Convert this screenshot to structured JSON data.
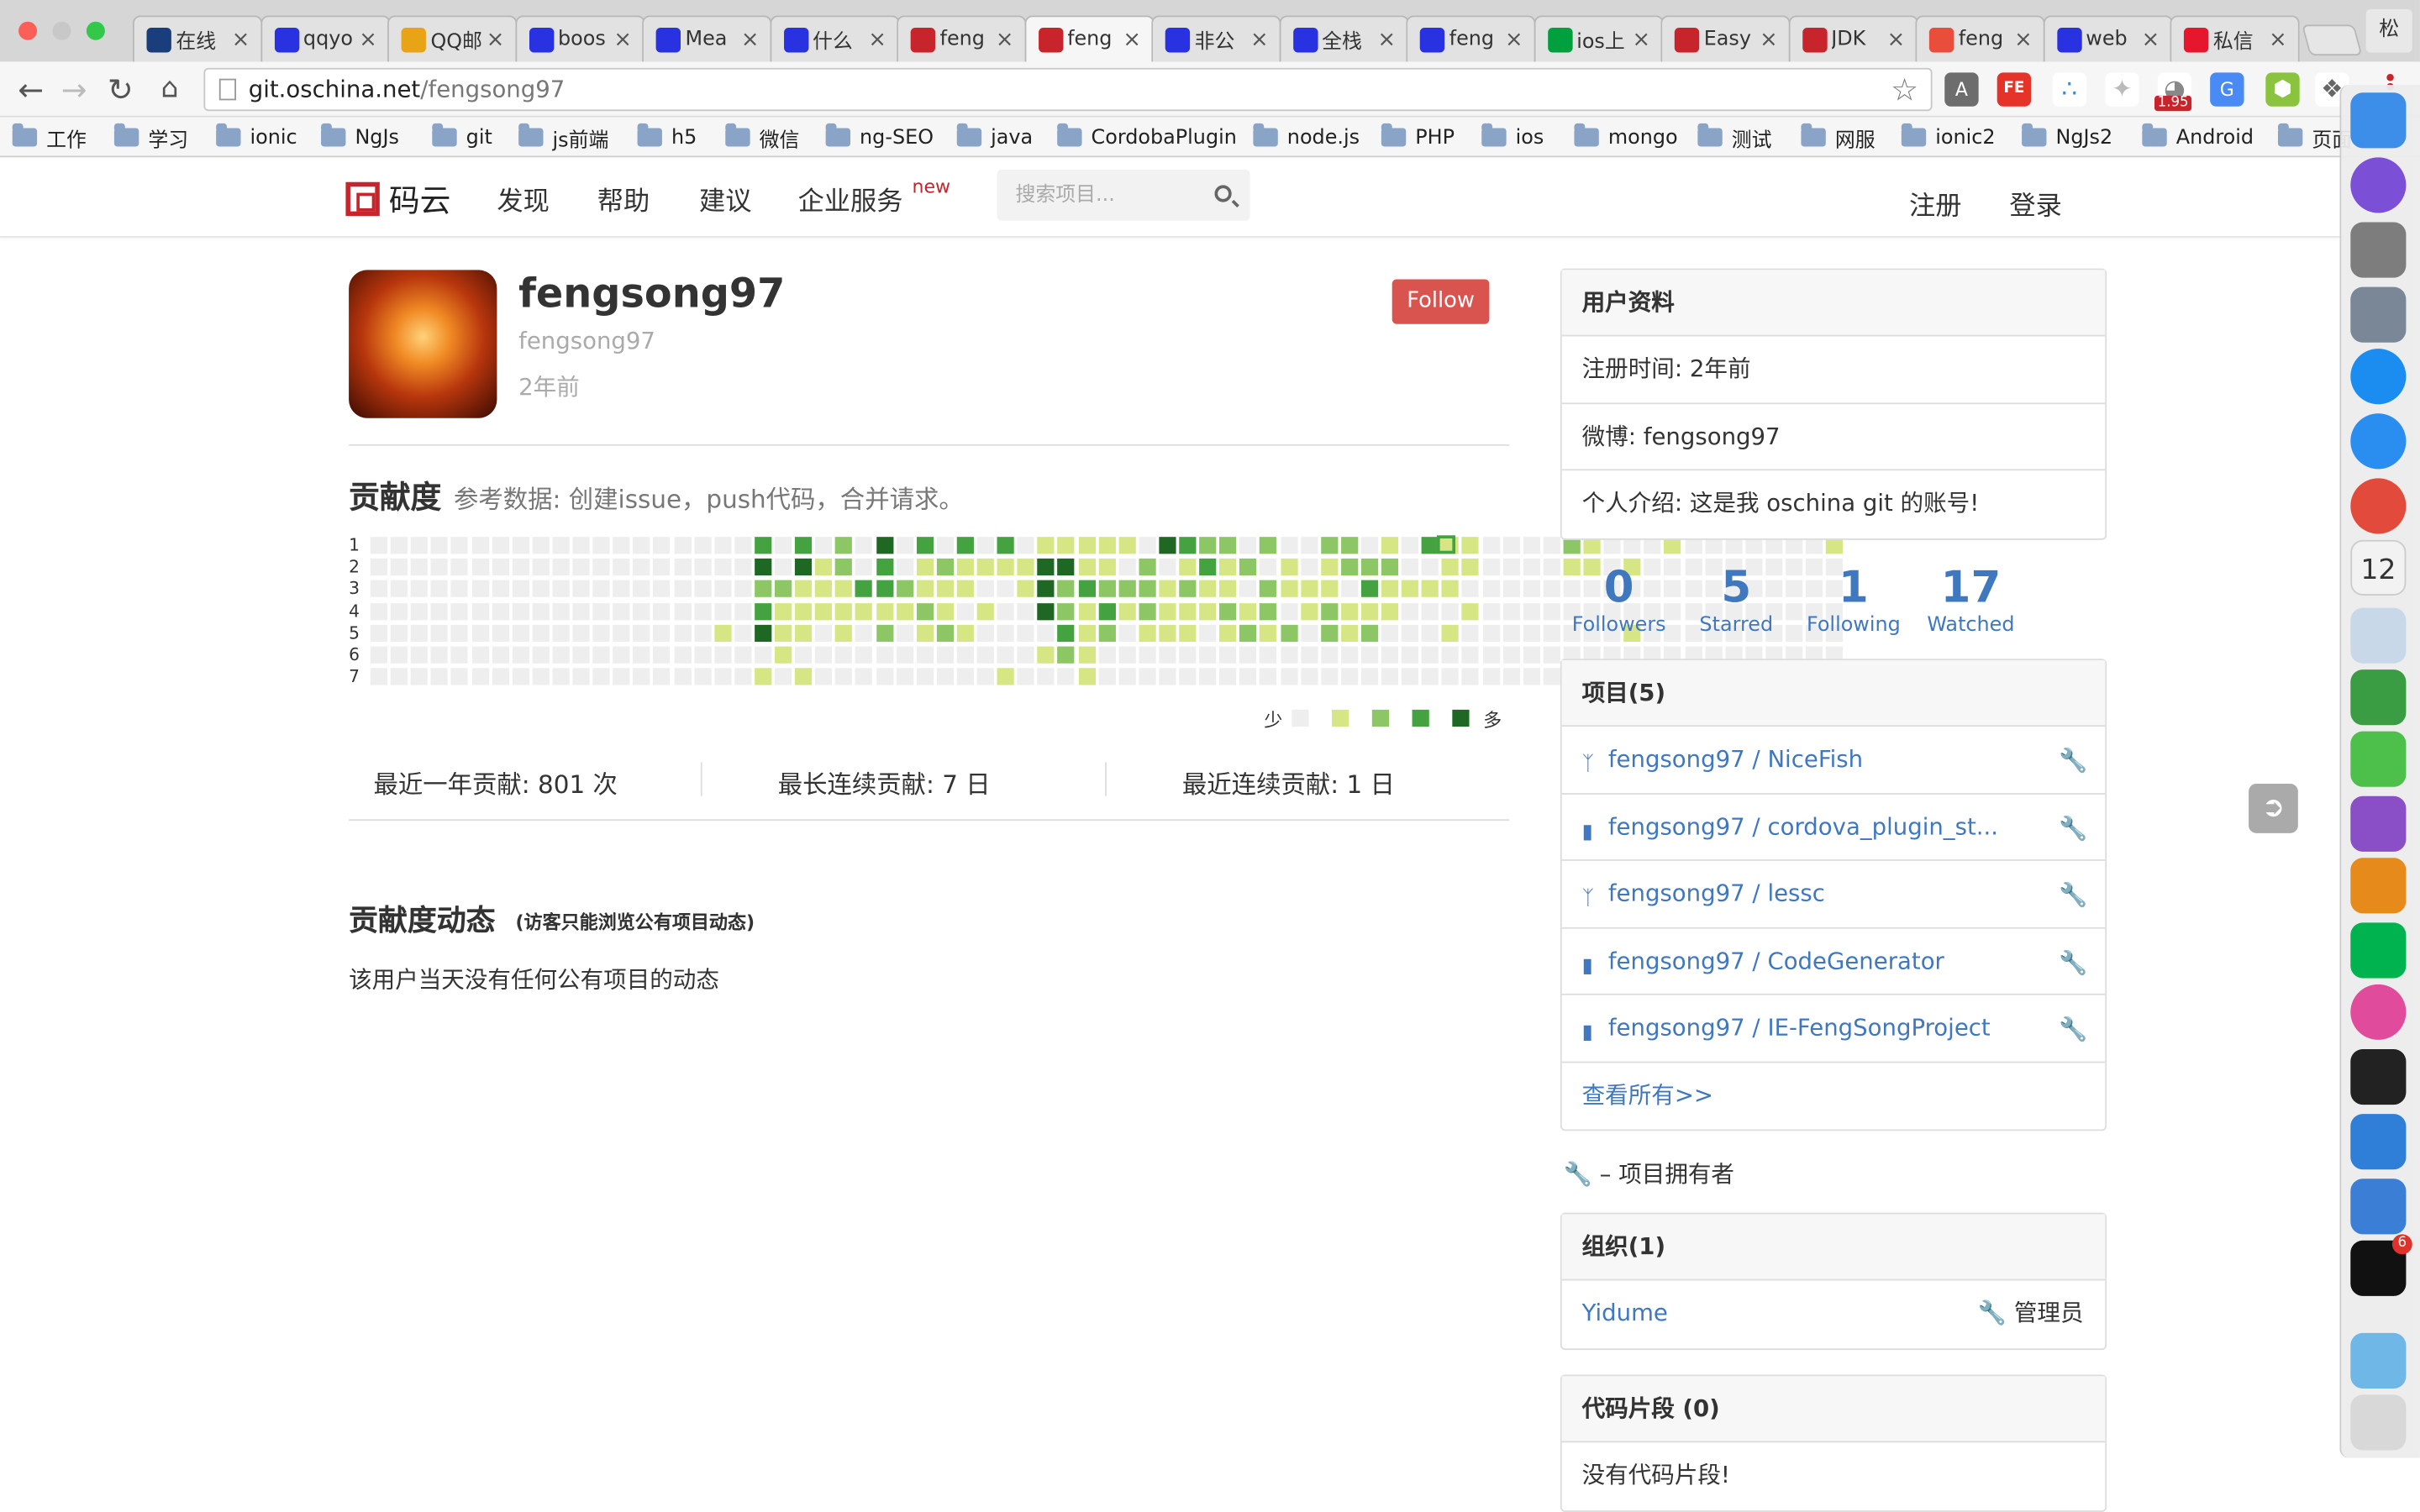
{
  "browser": {
    "tabs": [
      {
        "title": "在线",
        "icon": "h-icon",
        "color": "#1a3d7c"
      },
      {
        "title": "qqyo",
        "icon": "baidu-paw-icon",
        "color": "#2932e1"
      },
      {
        "title": "QQ邮",
        "icon": "chrome-icon",
        "color": "#e8a317"
      },
      {
        "title": "boos",
        "icon": "baidu-paw-icon",
        "color": "#2932e1"
      },
      {
        "title": "Mea",
        "icon": "baidu-paw-icon",
        "color": "#2932e1"
      },
      {
        "title": "什么",
        "icon": "baidu-paw-icon",
        "color": "#2932e1"
      },
      {
        "title": "feng",
        "icon": "oschina-icon",
        "color": "#c7252b"
      },
      {
        "title": "feng",
        "icon": "oschina-icon",
        "color": "#c7252b"
      },
      {
        "title": "非公",
        "icon": "baidu-paw-icon",
        "color": "#2932e1"
      },
      {
        "title": "全栈",
        "icon": "baidu-paw-icon",
        "color": "#2932e1"
      },
      {
        "title": "feng",
        "icon": "baidu-paw-icon",
        "color": "#2932e1"
      },
      {
        "title": "ios上",
        "icon": "sf-icon",
        "color": "#00a03e"
      },
      {
        "title": "Easy",
        "icon": "csdn-icon",
        "color": "#c7252b"
      },
      {
        "title": "JDK",
        "icon": "csdn-icon",
        "color": "#c7252b"
      },
      {
        "title": "feng",
        "icon": "flame-icon",
        "color": "#e94e3c"
      },
      {
        "title": "web",
        "icon": "baidu-paw-icon",
        "color": "#2932e1"
      },
      {
        "title": "私信",
        "icon": "weibo-icon",
        "color": "#e6162d"
      }
    ],
    "active_tab": 7,
    "address_domain": "git.oschina.net",
    "address_path": "/fengsong97",
    "ext_badge": "1.95",
    "bookmarks": [
      "工作",
      "学习",
      "ionic",
      "NgJs",
      "git",
      "js前端",
      "h5",
      "微信",
      "ng-SEO",
      "java",
      "CordobaPlugin",
      "node.js",
      "PHP",
      "ios",
      "mongo",
      "测试",
      "网服",
      "ionic2",
      "NgJs2",
      "Android",
      "页面"
    ],
    "user_initial": "松"
  },
  "site": {
    "logo_text": "码云",
    "nav": [
      "发现",
      "帮助",
      "建议",
      "企业服务"
    ],
    "new_badge": "new",
    "search_placeholder": "搜索项目...",
    "register": "注册",
    "login": "登录",
    "brand_color": "#c7252b"
  },
  "profile": {
    "name": "fengsong97",
    "login": "fengsong97",
    "joined": "2年前",
    "follow_label": "Follow"
  },
  "contrib": {
    "title": "贡献度",
    "ref": "参考数据: 创建issue，push代码，合并请求。",
    "day_labels": [
      "1",
      "2",
      "3",
      "4",
      "5",
      "6",
      "7"
    ],
    "legend_less": "少",
    "legend_more": "多",
    "levels": [
      "#eeeeee",
      "#d6e685",
      "#8cc665",
      "#44a340",
      "#1e6823"
    ],
    "grid": [
      "0000000000000000000303020403030301111104322020022010311000021000100000001",
      "0000000000000000000404120301211114411020131201012220011000011010000000000",
      "0000000000000000000221113321110014232221211021110311110000000000000000000",
      "0000000000000000000311111112101004213121112120121110001000000000000000000",
      "0000000000000000010411010201210000312011101212021200010000000010000000000",
      "0000000000000000000010000000000001210000000000000000000000000000000000000",
      "0000000000000000000101000000000100010000000000000000000000000000000000000"
    ],
    "year_total": "最近一年贡献: 801 次",
    "longest_streak": "最长连续贡献: 7 日",
    "current_streak": "最近连续贡献: 1 日"
  },
  "activity": {
    "title": "贡献度动态",
    "note": "(访客只能浏览公有项目动态)",
    "empty": "该用户当天没有任何公有项目的动态"
  },
  "sidebar": {
    "user_info": {
      "title": "用户资料",
      "rows": [
        "注册时间: 2年前",
        "微博: fengsong97",
        "个人介绍: 这是我 oschina git 的账号!"
      ]
    },
    "counts": [
      {
        "n": "0",
        "label": "Followers"
      },
      {
        "n": "5",
        "label": "Starred"
      },
      {
        "n": "1",
        "label": "Following"
      },
      {
        "n": "17",
        "label": "Watched"
      }
    ],
    "projects": {
      "title": "项目(5)",
      "items": [
        {
          "name": "fengsong97 / NiceFish",
          "icon": "fork-icon"
        },
        {
          "name": "fengsong97 / cordova_plugin_st...",
          "icon": "repo-icon"
        },
        {
          "name": "fengsong97 / lessc",
          "icon": "fork-icon"
        },
        {
          "name": "fengsong97 / CodeGenerator",
          "icon": "repo-icon"
        },
        {
          "name": "fengsong97 / IE-FengSongProject",
          "icon": "repo-icon"
        }
      ],
      "view_all": "查看所有>>"
    },
    "owner_note": "– 项目拥有者",
    "orgs": {
      "title": "组织(1)",
      "name": "Yidume",
      "role": "管理员"
    },
    "snippets": {
      "title": "代码片段 (0)",
      "empty": "没有代码片段!"
    }
  },
  "dock": {
    "apps": [
      {
        "icon": "finder-icon",
        "color": "#3d8ee8"
      },
      {
        "icon": "siri-icon",
        "color": "#7b4fd6"
      },
      {
        "icon": "system-preferences-icon",
        "color": "#7d7d7d"
      },
      {
        "icon": "launchpad-icon",
        "color": "#7a8796"
      },
      {
        "icon": "app-store-icon",
        "color": "#1b8cf0"
      },
      {
        "icon": "safari-icon",
        "color": "#2a8df0"
      },
      {
        "icon": "chrome-icon",
        "color": "#e24a3b"
      },
      {
        "icon": "calendar-icon",
        "color": "#f2f2f2"
      },
      {
        "icon": "preview-icon",
        "color": "#c9d8e8"
      },
      {
        "icon": "evernote-icon",
        "color": "#3a9d43"
      },
      {
        "icon": "wechat-icon",
        "color": "#4cc04a"
      },
      {
        "icon": "github-icon",
        "color": "#8a4ec7"
      },
      {
        "icon": "sublime-icon",
        "color": "#e58a1b"
      },
      {
        "icon": "iqiyi-icon",
        "color": "#00b34e"
      },
      {
        "icon": "itunes-icon",
        "color": "#e04c9b"
      },
      {
        "icon": "terminal-icon",
        "color": "#222222"
      },
      {
        "icon": "xcode-icon",
        "color": "#2f7fd8"
      },
      {
        "icon": "simulator-icon",
        "color": "#3a7fd5"
      },
      {
        "icon": "qq-icon",
        "color": "#111111"
      },
      {
        "icon": "downloads-icon",
        "color": "#6fb7e6"
      },
      {
        "icon": "trash-icon",
        "color": "#d8d8d8"
      }
    ],
    "calendar_day": "12",
    "qq_badge": "6"
  }
}
